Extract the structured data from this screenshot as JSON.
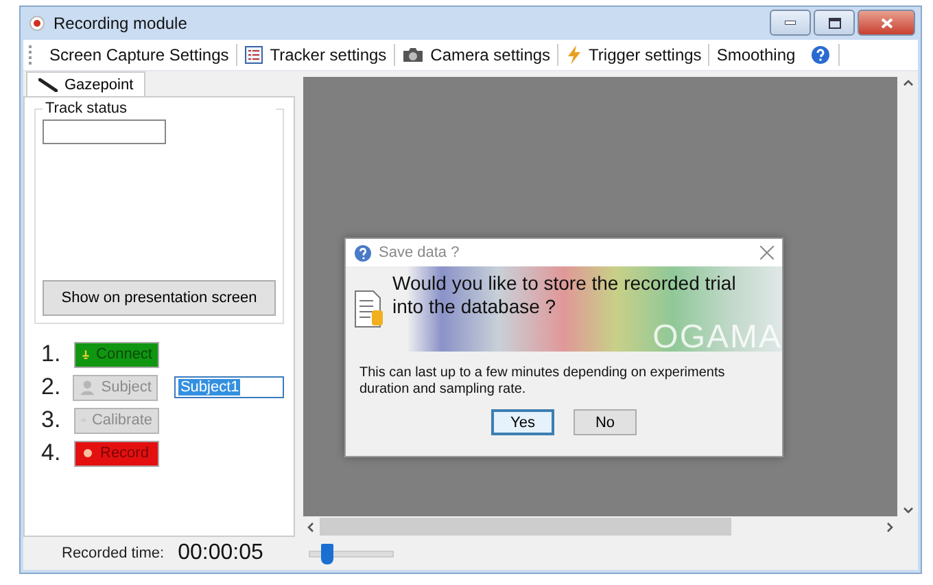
{
  "window": {
    "title": "Recording module"
  },
  "toolbar": [
    {
      "label": "Screen Capture Settings",
      "kind": "plain"
    },
    {
      "label": "Tracker settings",
      "kind": "list"
    },
    {
      "label": "Camera settings",
      "kind": "camera"
    },
    {
      "label": "Trigger settings",
      "kind": "bolt"
    },
    {
      "label": "Smoothing",
      "kind": "plain"
    }
  ],
  "tabs": [
    {
      "label": "Gazepoint",
      "selected": true
    }
  ],
  "track_status": {
    "label": "Track status"
  },
  "show_button": "Show on presentation screen",
  "steps": [
    {
      "number": "1.",
      "label": "Connect",
      "kind": "connect",
      "disabled": false
    },
    {
      "number": "2.",
      "label": "Subject",
      "kind": "subject",
      "disabled": true
    },
    {
      "number": "3.",
      "label": "Calibrate",
      "kind": "calibrate",
      "disabled": true
    },
    {
      "number": "4.",
      "label": "Record",
      "kind": "record",
      "disabled": false
    }
  ],
  "subject_field": {
    "value": "Subject1"
  },
  "recorded_time": {
    "label": "Recorded time:",
    "value": "00:00:05"
  },
  "slider": {
    "level": 0.2
  },
  "dialog": {
    "title": "Save data ?",
    "question": "Would you like to store the recorded trial into the database ?",
    "banner": "OGAMA",
    "message": "This can last up to a few minutes depending on experiments duration and sampling rate.",
    "buttons": [
      {
        "label": "Yes",
        "selected": true
      },
      {
        "label": "No",
        "selected": false
      }
    ]
  }
}
